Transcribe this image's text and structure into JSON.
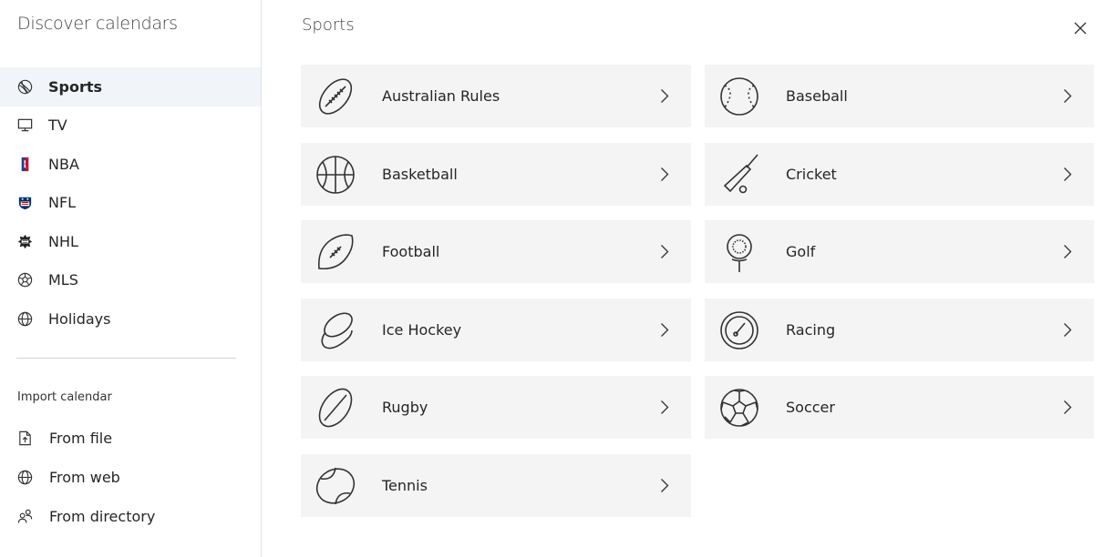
{
  "sidebar": {
    "title": "Discover calendars",
    "items": [
      {
        "label": "Sports",
        "icon": "sports-icon",
        "active": true
      },
      {
        "label": "TV",
        "icon": "tv-icon"
      },
      {
        "label": "NBA",
        "icon": "nba-logo-icon"
      },
      {
        "label": "NFL",
        "icon": "nfl-logo-icon"
      },
      {
        "label": "NHL",
        "icon": "nhl-logo-icon"
      },
      {
        "label": "MLS",
        "icon": "mls-logo-icon"
      },
      {
        "label": "Holidays",
        "icon": "globe-icon"
      }
    ],
    "import_heading": "Import calendar",
    "import_items": [
      {
        "label": "From file",
        "icon": "file-icon"
      },
      {
        "label": "From web",
        "icon": "globe-icon"
      },
      {
        "label": "From directory",
        "icon": "people-icon"
      }
    ]
  },
  "main": {
    "title": "Sports",
    "close_icon": "close-icon",
    "tiles": [
      {
        "label": "Australian Rules",
        "icon": "australian-rules-ball-icon"
      },
      {
        "label": "Baseball",
        "icon": "baseball-icon"
      },
      {
        "label": "Basketball",
        "icon": "basketball-icon"
      },
      {
        "label": "Cricket",
        "icon": "cricket-bat-icon"
      },
      {
        "label": "Football",
        "icon": "football-icon"
      },
      {
        "label": "Golf",
        "icon": "golf-ball-tee-icon"
      },
      {
        "label": "Ice Hockey",
        "icon": "hockey-puck-icon"
      },
      {
        "label": "Racing",
        "icon": "speedometer-icon"
      },
      {
        "label": "Rugby",
        "icon": "rugby-ball-icon"
      },
      {
        "label": "Soccer",
        "icon": "soccer-ball-icon"
      },
      {
        "label": "Tennis",
        "icon": "tennis-ball-icon"
      }
    ]
  },
  "colors": {
    "tile_background": "#f4f4f4",
    "active_item_background": "#f1f4f9",
    "text": "#262626",
    "nba_red": "#c8102e",
    "nba_blue": "#1d428a",
    "nfl_navy": "#013369",
    "nfl_red": "#d50a0a"
  }
}
